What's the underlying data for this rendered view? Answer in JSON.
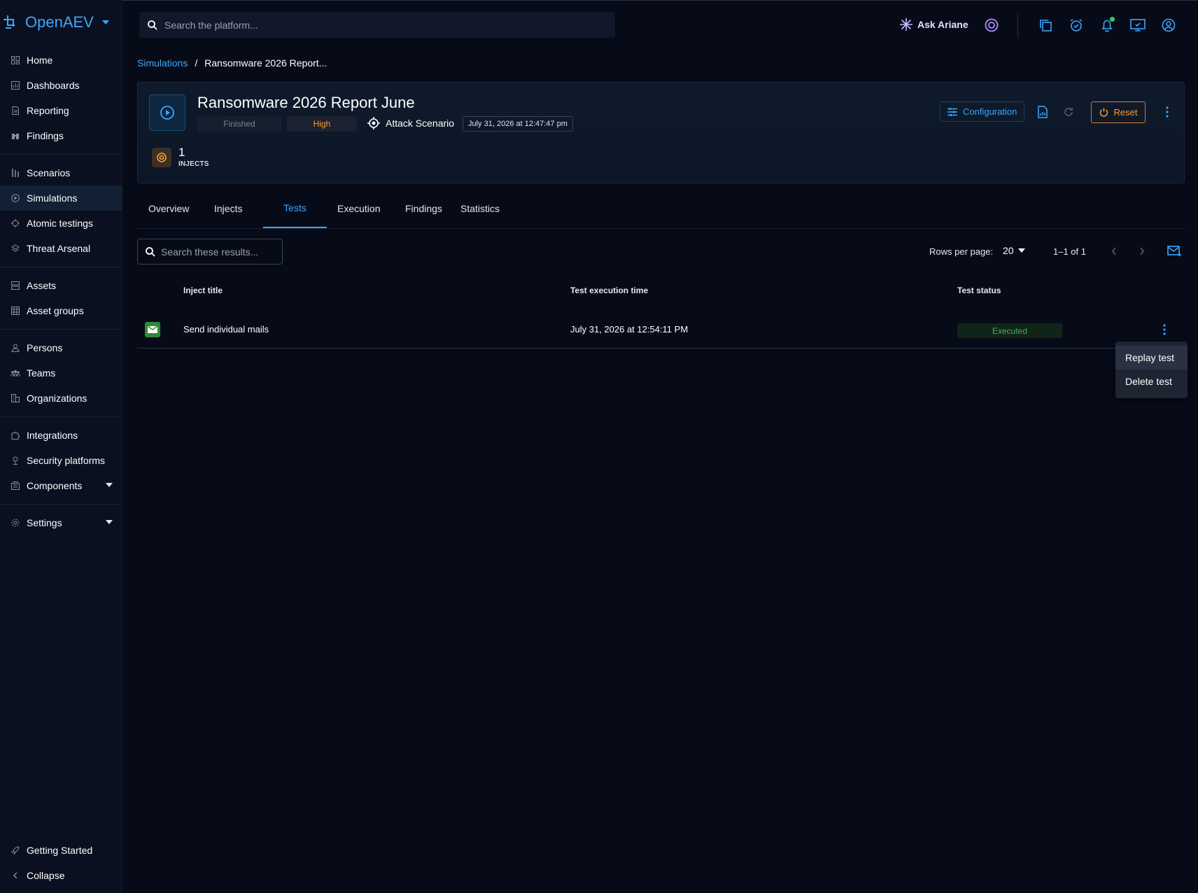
{
  "app": {
    "brand": "OpenAEV"
  },
  "sidebar": {
    "groups": [
      [
        {
          "label": "Home",
          "icon": "home-icon"
        },
        {
          "label": "Dashboards",
          "icon": "dashboard-icon"
        },
        {
          "label": "Reporting",
          "icon": "report-icon"
        },
        {
          "label": "Findings",
          "icon": "binoculars-icon"
        }
      ],
      [
        {
          "label": "Scenarios",
          "icon": "scenario-icon"
        },
        {
          "label": "Simulations",
          "icon": "play-circle-icon",
          "active": true
        },
        {
          "label": "Atomic testings",
          "icon": "crosshair-icon"
        },
        {
          "label": "Threat Arsenal",
          "icon": "layers-icon"
        }
      ],
      [
        {
          "label": "Assets",
          "icon": "server-icon"
        },
        {
          "label": "Asset groups",
          "icon": "grid-icon"
        }
      ],
      [
        {
          "label": "Persons",
          "icon": "person-icon"
        },
        {
          "label": "Teams",
          "icon": "group-icon"
        },
        {
          "label": "Organizations",
          "icon": "building-icon"
        }
      ],
      [
        {
          "label": "Integrations",
          "icon": "puzzle-icon"
        },
        {
          "label": "Security platforms",
          "icon": "shield-user-icon"
        },
        {
          "label": "Components",
          "icon": "components-icon",
          "expandable": true
        }
      ],
      [
        {
          "label": "Settings",
          "icon": "gear-icon",
          "expandable": true
        }
      ]
    ],
    "bottom": [
      {
        "label": "Getting Started",
        "icon": "rocket-icon"
      },
      {
        "label": "Collapse",
        "icon": "chevron-left-icon"
      }
    ]
  },
  "topbar": {
    "search_placeholder": "Search the platform...",
    "ask_label": "Ask Ariane"
  },
  "breadcrumb": {
    "parent": "Simulations",
    "separator": "/",
    "current": "Ransomware 2026 Report..."
  },
  "simulation": {
    "title": "Ransomware 2026 Report June",
    "status": "Finished",
    "severity": "High",
    "scenario_label": "Attack Scenario",
    "date": "July 31, 2026 at 12:47:47 pm",
    "injects_count": "1",
    "injects_label": "INJECTS"
  },
  "actions": {
    "configuration": "Configuration",
    "reset": "Reset"
  },
  "tabs": [
    "Overview",
    "Injects",
    "Tests",
    "Execution",
    "Findings",
    "Statistics"
  ],
  "active_tab": "Tests",
  "toolbar": {
    "search_placeholder": "Search these results...",
    "rows_per_page_label": "Rows per page:",
    "rows_per_page_value": "20",
    "range": "1–1 of 1"
  },
  "table": {
    "headers": [
      "Inject title",
      "Test execution time",
      "Test status"
    ],
    "rows": [
      {
        "title": "Send individual mails",
        "time": "July 31, 2026 at 12:54:11 PM",
        "status": "Executed"
      }
    ]
  },
  "context_menu": [
    "Replay test",
    "Delete test"
  ],
  "colors": {
    "accent": "#3ba6ff",
    "warning": "#ff9d2e",
    "success": "#3cb45a",
    "background": "#070b18"
  }
}
